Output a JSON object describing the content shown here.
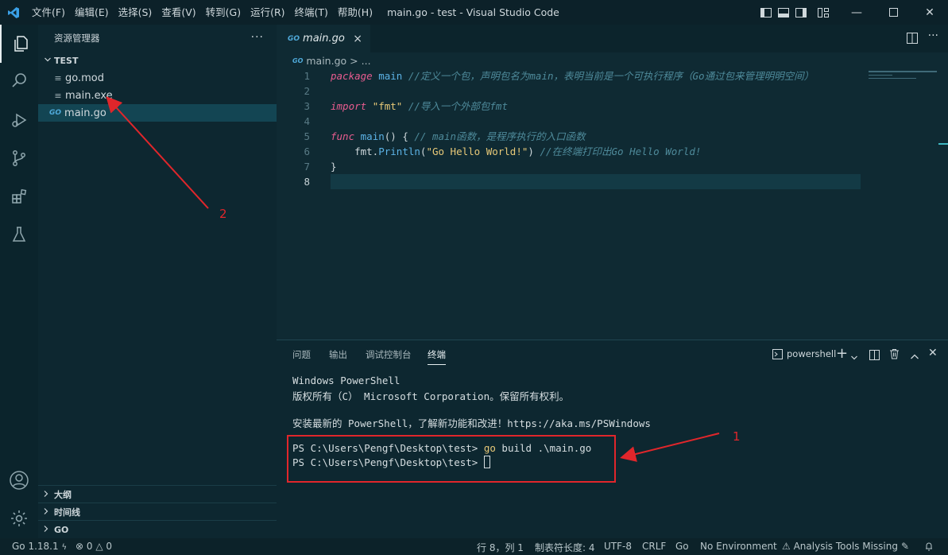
{
  "titlebar": {
    "menu": [
      "文件(F)",
      "编辑(E)",
      "选择(S)",
      "查看(V)",
      "转到(G)",
      "运行(R)",
      "终端(T)",
      "帮助(H)"
    ],
    "title": "main.go - test - Visual Studio Code"
  },
  "sidebar": {
    "title": "资源管理器",
    "more": "···",
    "folder": "TEST",
    "files": [
      {
        "name": "go.mod",
        "icon": "lines-icon"
      },
      {
        "name": "main.exe",
        "icon": "lines-icon"
      },
      {
        "name": "main.go",
        "icon": "go-icon",
        "go_label": "GO"
      }
    ],
    "sections": [
      "大纲",
      "时间线",
      "GO"
    ]
  },
  "editor": {
    "tab_label": "main.go",
    "tab_close": "×",
    "breadcrumb": "main.go",
    "breadcrumb_rest": "> ...",
    "go_badge": "GO",
    "lines": [
      {
        "no": "1",
        "parts": [
          [
            "kw",
            "package"
          ],
          [
            "pl",
            " "
          ],
          [
            "fn",
            "main"
          ],
          [
            "pl",
            " "
          ],
          [
            "cmt",
            "//定义一个包，声明包名为main，表明当前是一个可执行程序（Go通过包来管理明明空间）"
          ]
        ]
      },
      {
        "no": "2",
        "parts": []
      },
      {
        "no": "3",
        "parts": [
          [
            "kw",
            "import"
          ],
          [
            "pl",
            " "
          ],
          [
            "str",
            "\"fmt\""
          ],
          [
            "pl",
            " "
          ],
          [
            "cmt",
            "//导入一个外部包fmt"
          ]
        ]
      },
      {
        "no": "4",
        "parts": []
      },
      {
        "no": "5",
        "parts": [
          [
            "kw",
            "func"
          ],
          [
            "pl",
            " "
          ],
          [
            "fn",
            "main"
          ],
          [
            "pl",
            "() { "
          ],
          [
            "cmt",
            "// main函数，是程序执行的入口函数"
          ]
        ]
      },
      {
        "no": "6",
        "parts": [
          [
            "pl",
            "    fmt."
          ],
          [
            "fn",
            "Println"
          ],
          [
            "pl",
            "("
          ],
          [
            "str",
            "\"Go Hello World!\""
          ],
          [
            "pl",
            ") "
          ],
          [
            "cmt",
            "//在终端打印出Go Hello World!"
          ]
        ]
      },
      {
        "no": "7",
        "parts": [
          [
            "pl",
            "}"
          ]
        ]
      },
      {
        "no": "8",
        "parts": []
      }
    ]
  },
  "panel": {
    "tabs": [
      "问题",
      "输出",
      "调试控制台",
      "终端"
    ],
    "shell_label": "powershell",
    "terminal_lines": [
      "Windows PowerShell",
      "版权所有（C） Microsoft Corporation。保留所有权利。",
      "",
      "安装最新的 PowerShell，了解新功能和改进！https://aka.ms/PSWindows",
      "",
      "PS C:\\Users\\Pengf\\Desktop\\test> ",
      "PS C:\\Users\\Pengf\\Desktop\\test> "
    ],
    "command_cmd": "go",
    "command_args": " build .\\main.go"
  },
  "status": {
    "go_version": "Go 1.18.1",
    "errors": "0",
    "warnings": "0",
    "position": "行 8，列 1",
    "tab_size": "制表符长度: 4",
    "encoding": "UTF-8",
    "eol": "CRLF",
    "language": "Go",
    "environment": "No Environment",
    "analysis": "Analysis Tools Missing"
  },
  "annotations": {
    "label_1": "1",
    "label_2": "2"
  },
  "colors": {
    "accent_red": "#e0262b",
    "keyword": "#e75c8f",
    "function": "#5cb3e6",
    "string": "#e8c978",
    "comment": "#4e8a9a"
  }
}
